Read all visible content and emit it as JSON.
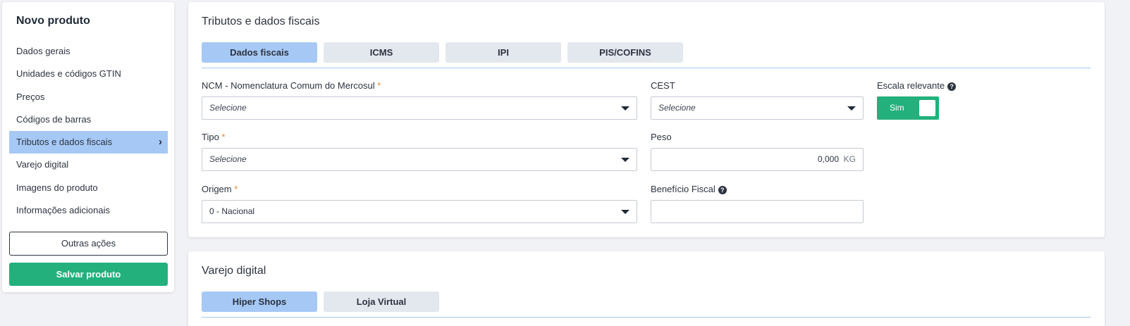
{
  "sidebar": {
    "title": "Novo produto",
    "items": [
      {
        "label": "Dados gerais"
      },
      {
        "label": "Unidades e códigos GTIN"
      },
      {
        "label": "Preços"
      },
      {
        "label": "Códigos de barras"
      },
      {
        "label": "Tributos e dados fiscais",
        "active": true
      },
      {
        "label": "Varejo digital"
      },
      {
        "label": "Imagens do produto"
      },
      {
        "label": "Informações adicionais"
      }
    ],
    "other_actions_label": "Outras ações",
    "save_label": "Salvar produto"
  },
  "tributos": {
    "title": "Tributos e dados fiscais",
    "tabs": [
      {
        "label": "Dados fiscais",
        "active": true
      },
      {
        "label": "ICMS"
      },
      {
        "label": "IPI"
      },
      {
        "label": "PIS/COFINS"
      }
    ],
    "ncm": {
      "label": "NCM - Nomenclatura Comum do Mercosul",
      "value": "Selecione"
    },
    "cest": {
      "label": "CEST",
      "value": "Selecione"
    },
    "escala": {
      "label": "Escala relevante",
      "value": "Sim",
      "on": true
    },
    "tipo": {
      "label": "Tipo",
      "value": "Selecione"
    },
    "peso": {
      "label": "Peso",
      "value": "0,000",
      "unit": "KG"
    },
    "origem": {
      "label": "Origem",
      "value": "0 - Nacional"
    },
    "beneficio": {
      "label": "Benefício Fiscal",
      "value": ""
    },
    "required_mark": "*",
    "help_glyph": "?"
  },
  "varejo": {
    "title": "Varejo digital",
    "tabs": [
      {
        "label": "Hiper Shops",
        "active": true
      },
      {
        "label": "Loja Virtual"
      }
    ]
  },
  "colors": {
    "accent_blue": "#a6c8f5",
    "primary_green": "#23b07d",
    "required_orange": "#e38a2b"
  },
  "icons": {
    "nav_chevron": "chevron-right-icon",
    "dropdown": "caret-down-icon",
    "help": "question-circle-icon"
  }
}
